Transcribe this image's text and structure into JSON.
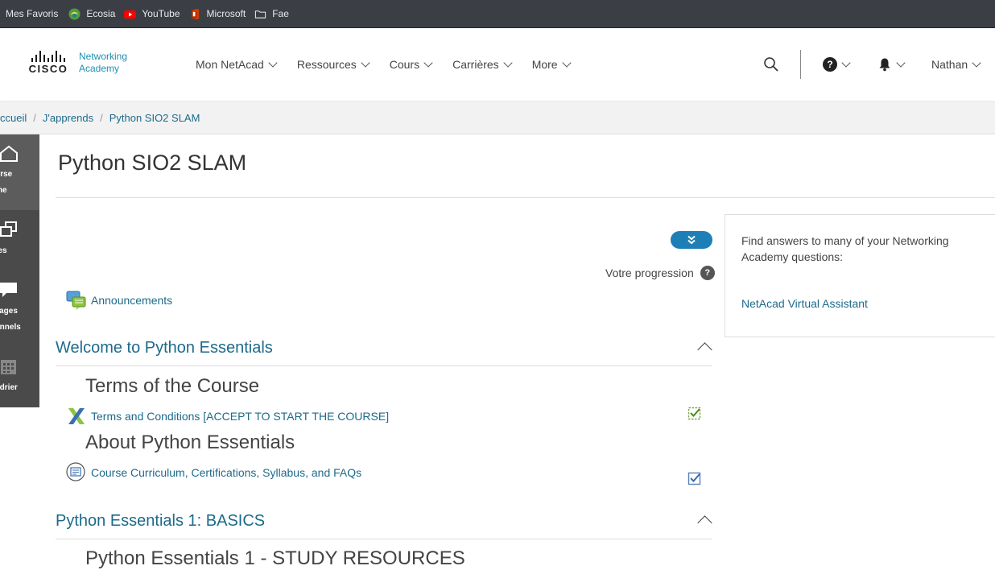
{
  "bookmarks": [
    {
      "label": "Mes Favoris",
      "icon": "none"
    },
    {
      "label": "Ecosia",
      "icon": "ecosia-icon"
    },
    {
      "label": "YouTube",
      "icon": "youtube-icon"
    },
    {
      "label": "Microsoft",
      "icon": "microsoft-office-icon"
    },
    {
      "label": "Fae",
      "icon": "folder-icon"
    }
  ],
  "header": {
    "logo_word": "CISCO",
    "logo_line1": "Networking",
    "logo_line2": "Academy",
    "nav": [
      "Mon NetAcad",
      "Ressources",
      "Cours",
      "Carrières",
      "More"
    ],
    "help_symbol": "?",
    "user": "Nathan"
  },
  "breadcrumb": [
    "ccueil",
    "J'apprends",
    "Python SIO2 SLAM"
  ],
  "sidebar": [
    {
      "label1": "ourse",
      "label2": "ome",
      "icon": "home-icon",
      "active": true
    },
    {
      "label1": "otes",
      "label2": "",
      "icon": "notes-icon",
      "active": false
    },
    {
      "label1": "ssages",
      "label2": "sonnels",
      "icon": "message-icon",
      "active": false
    },
    {
      "label1": "endrier",
      "label2": "",
      "icon": "calendar-icon",
      "active": false
    }
  ],
  "main": {
    "title": "Python SIO2 SLAM",
    "progress_label": "Votre progression",
    "progress_help": "?",
    "announcements": "Announcements",
    "sections": [
      {
        "title": "Welcome to Python Essentials",
        "subsections": [
          {
            "title": "Terms of the Course",
            "activity": "Terms and Conditions [ACCEPT TO START THE COURSE]",
            "completed": true
          },
          {
            "title": "About Python Essentials",
            "activity": "Course Curriculum, Certifications, Syllabus, and FAQs",
            "completed": true
          }
        ]
      },
      {
        "title": "Python Essentials 1: BASICS",
        "subsections": [
          {
            "title": "Python Essentials 1 - STUDY RESOURCES"
          }
        ]
      }
    ]
  },
  "side_block": {
    "text": "Find answers to many of your Networking Academy questions:",
    "link": "NetAcad Virtual Assistant"
  },
  "colors": {
    "link": "#1d6a8a",
    "accent_button": "#1d7fb5",
    "sidebar_bg": "#4a4a4a",
    "bookmarks_bg": "#3b3f45"
  }
}
